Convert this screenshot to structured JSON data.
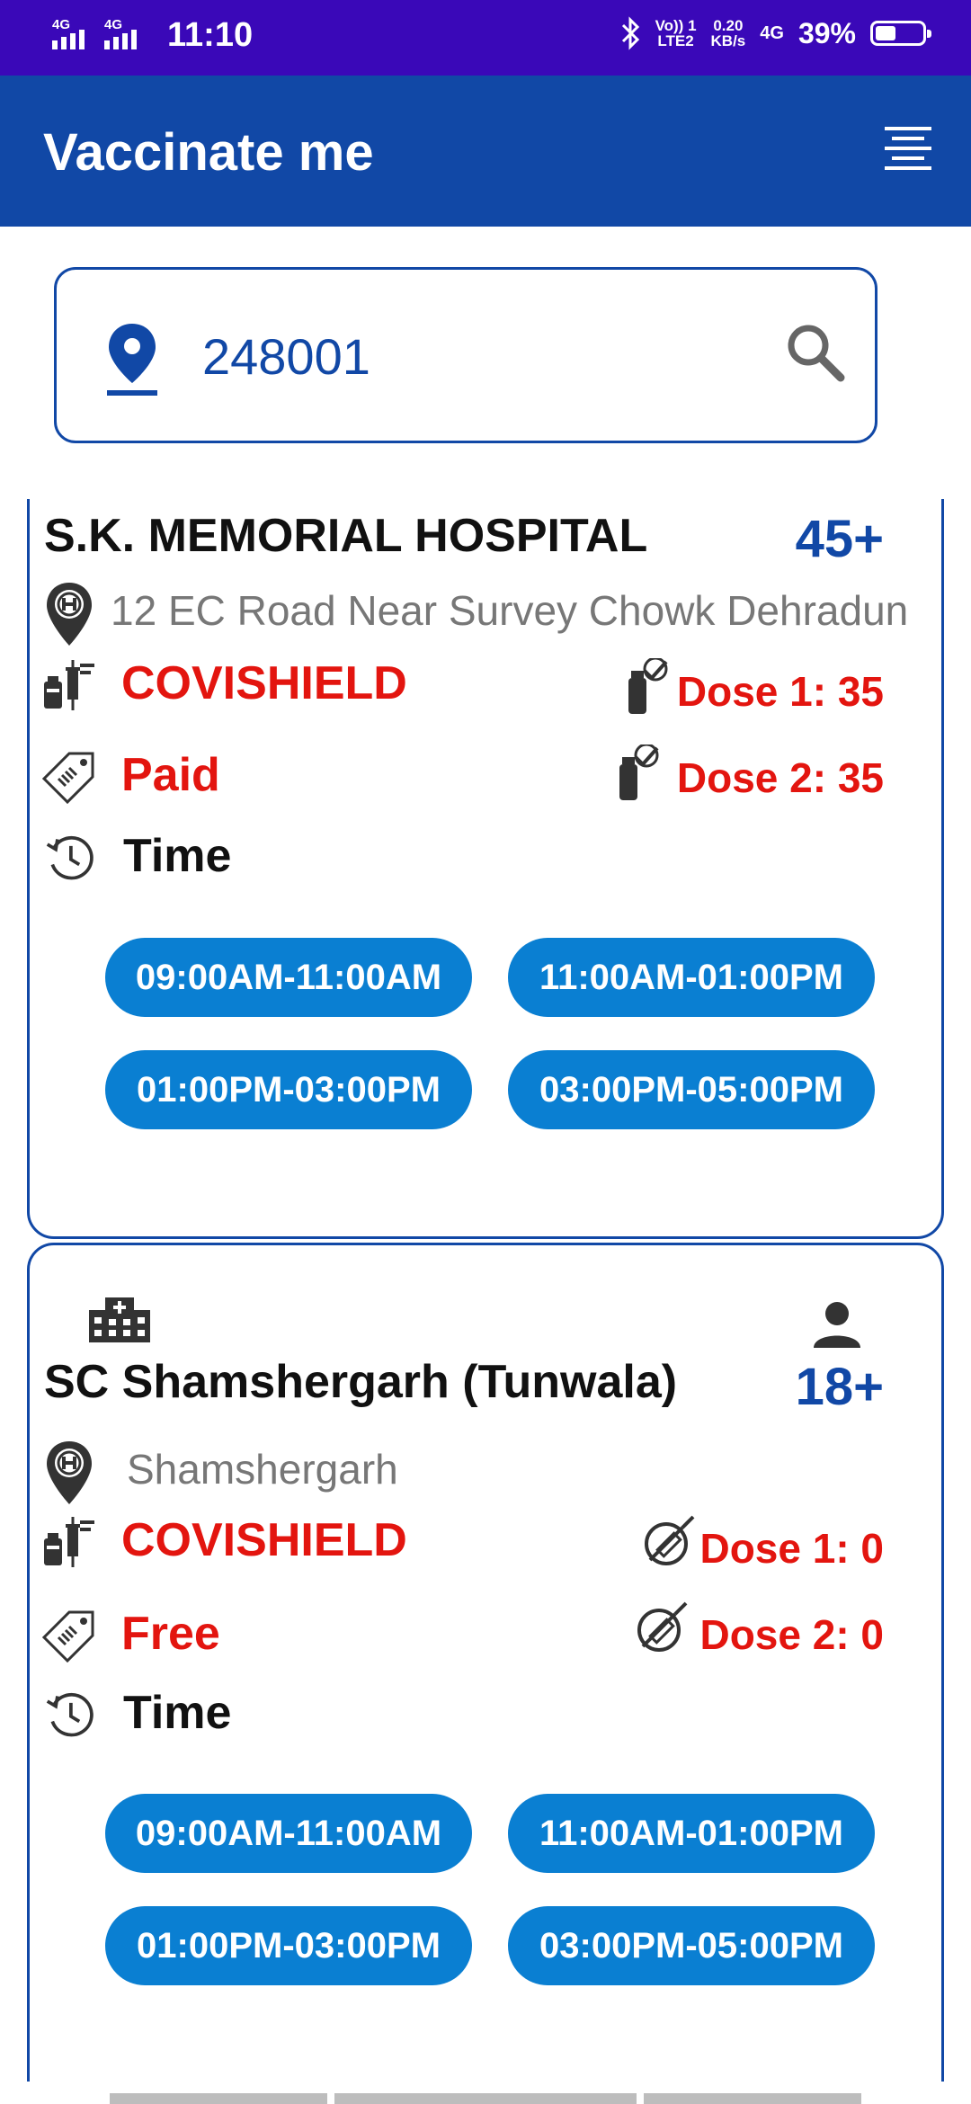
{
  "status_bar": {
    "net1": "4G",
    "net2": "4G",
    "time": "11:10",
    "volte": "Vo)) 1\nLTE2",
    "speed": "0.20\nKB/s",
    "net3": "4G",
    "battery_pct": "39%",
    "battery_level": 0.39
  },
  "app_bar": {
    "title": "Vaccinate me",
    "menu_icon": "menu-icon"
  },
  "search": {
    "value": "248001",
    "pin_icon": "location-pin-icon",
    "search_icon": "search-icon"
  },
  "colors": {
    "primary": "#1148a6",
    "status_bar": "#3a08b8",
    "slot": "#0a7fd2",
    "accent_red": "#e3150f"
  },
  "centers": [
    {
      "name": "S.K. MEMORIAL HOSPITAL",
      "age": "45+",
      "address": "12 EC Road Near Survey Chowk Dehradun",
      "vaccine": "COVISHIELD",
      "fee": "Paid",
      "time_label": "Time",
      "dose1": "Dose 1: 35",
      "dose2": "Dose 2: 35",
      "slots": [
        "09:00AM-11:00AM",
        "11:00AM-01:00PM",
        "01:00PM-03:00PM",
        "03:00PM-05:00PM"
      ]
    },
    {
      "name": "SC Shamshergarh (Tunwala)",
      "age": "18+",
      "address": "Shamshergarh",
      "vaccine": "COVISHIELD",
      "fee": "Free",
      "time_label": "Time",
      "dose1": "Dose 1: 0",
      "dose2": "Dose 2: 0",
      "slots": [
        "09:00AM-11:00AM",
        "11:00AM-01:00PM",
        "01:00PM-03:00PM",
        "03:00PM-05:00PM"
      ]
    }
  ]
}
